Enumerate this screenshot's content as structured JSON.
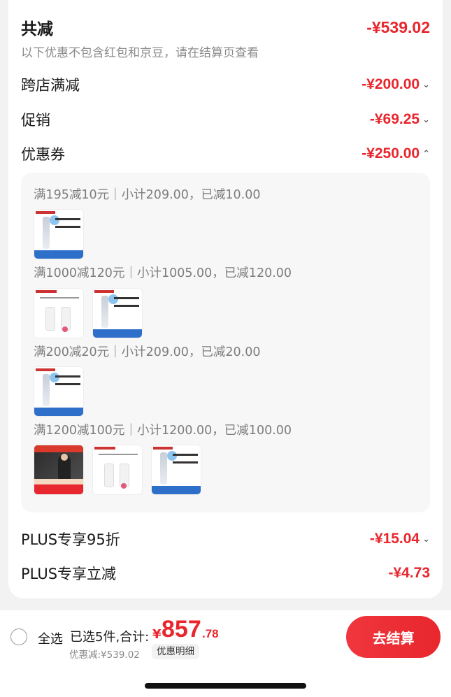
{
  "summary": {
    "title": "共减",
    "total": "-¥539.02",
    "note": "以下优惠不包含红包和京豆，请在结算页查看"
  },
  "rows": [
    {
      "label": "跨店满减",
      "amount": "-¥200.00",
      "chevron": "down"
    },
    {
      "label": "促销",
      "amount": "-¥69.25",
      "chevron": "down"
    },
    {
      "label": "优惠券",
      "amount": "-¥250.00",
      "chevron": "up"
    }
  ],
  "coupon_groups": [
    {
      "title": "满195减10元｜小计209.00，已减10.00",
      "products": [
        "serum"
      ]
    },
    {
      "title": "满1000减120元｜小计1005.00，已减120.00",
      "products": [
        "essence",
        "serum"
      ]
    },
    {
      "title": "满200减20元｜小计209.00，已减20.00",
      "products": [
        "serum"
      ]
    },
    {
      "title": "满1200减100元｜小计1200.00，已减100.00",
      "products": [
        "cushion",
        "essence",
        "serum"
      ]
    }
  ],
  "plus_rows": [
    {
      "label": "PLUS专享95折",
      "amount": "-¥15.04",
      "chevron": "down"
    },
    {
      "label": "PLUS专享立减",
      "amount": "-¥4.73"
    }
  ],
  "footer": {
    "select_all": "全选",
    "selected_text": "已选5件,合计:",
    "currency": "¥",
    "total_int": "857",
    "total_dec": ".78",
    "discount": "优惠减:¥539.02",
    "detail_button": "优惠明细",
    "checkout_button": "去结算"
  },
  "colors": {
    "accent": "#e8262d",
    "muted": "#8a8a8a"
  }
}
